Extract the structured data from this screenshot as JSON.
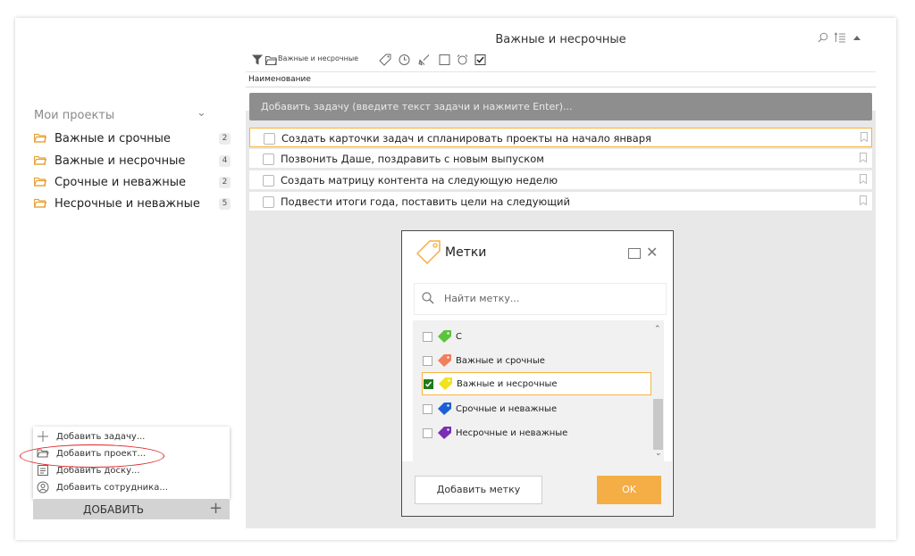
{
  "sidebar": {
    "section_label": "Мои проекты",
    "projects": [
      {
        "name": "Важные и срочные",
        "count": "2"
      },
      {
        "name": "Важные и несрочные",
        "count": "4"
      },
      {
        "name": "Срочные и неважные",
        "count": "2"
      },
      {
        "name": "Несрочные и неважные",
        "count": "5"
      }
    ]
  },
  "add_menu": {
    "items": [
      {
        "label": "Добавить задачу...",
        "icon": "plus-icon"
      },
      {
        "label": "Добавить проект...",
        "icon": "folder-icon"
      },
      {
        "label": "Добавить доску...",
        "icon": "board-icon"
      },
      {
        "label": "Добавить сотрудника...",
        "icon": "user-icon"
      }
    ],
    "button_label": "ДОБАВИТЬ",
    "button_plus": "+"
  },
  "main": {
    "title": "Важные и несрочные",
    "toolbar": {
      "project_filter": "Важные и несрочные"
    },
    "column_header": "Наименование",
    "add_task_placeholder": "Добавить задачу (введите текст задачи и нажмите Enter)...",
    "tasks": [
      {
        "text": "Создать карточки задач и спланировать проекты на начало января"
      },
      {
        "text": "Позвонить Даше, поздравить с новым выпуском"
      },
      {
        "text": "Создать матрицу контента на следующую неделю"
      },
      {
        "text": "Подвести итоги года, поставить цели на следующий"
      }
    ]
  },
  "dialog": {
    "title": "Метки",
    "search_placeholder": "Найти метку...",
    "labels": [
      {
        "name": "С",
        "color": "#5cc33f",
        "checked": false
      },
      {
        "name": "Важные и срочные",
        "color": "#f07f5e",
        "checked": false
      },
      {
        "name": "Важные и несрочные",
        "color": "#f2e21b",
        "checked": true
      },
      {
        "name": "Срочные и неважные",
        "color": "#1f5fd6",
        "checked": false
      },
      {
        "name": "Несрочные и неважные",
        "color": "#7a2fb3",
        "checked": false
      }
    ],
    "add_button": "Добавить метку",
    "ok_button": "OK"
  },
  "colors": {
    "accent": "#f5ad45",
    "highlight_border": "#f5b342",
    "annotation": "#e02020"
  }
}
